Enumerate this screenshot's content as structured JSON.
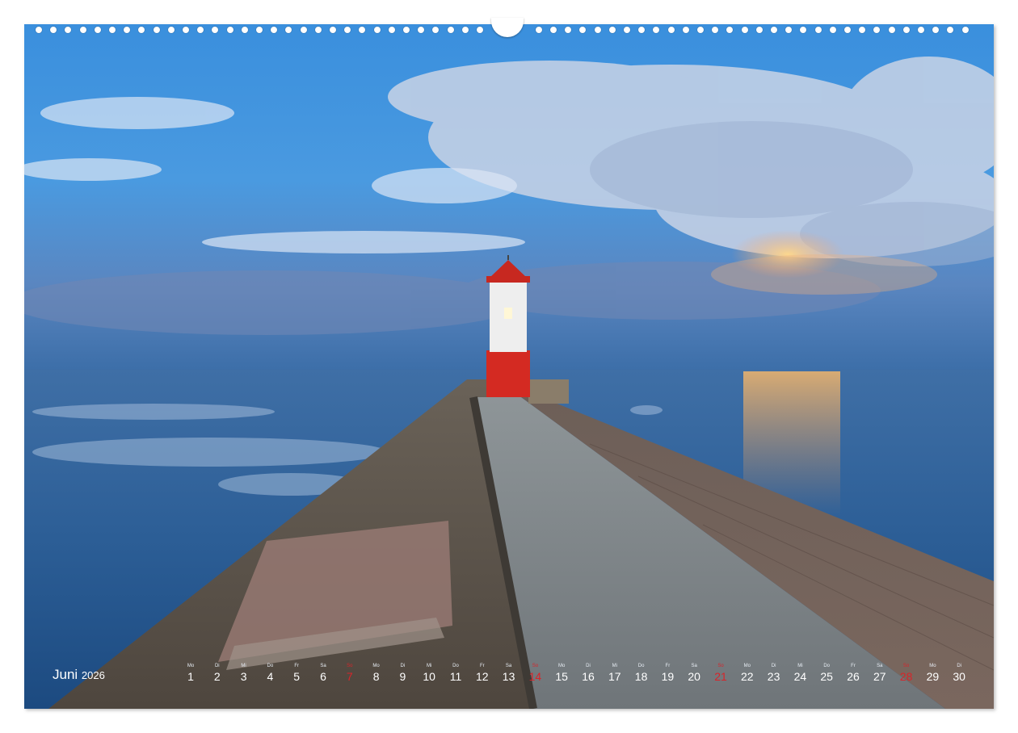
{
  "calendar": {
    "month": "Juni",
    "year": "2026",
    "days": [
      {
        "wd": "Mo",
        "n": "1",
        "sun": false
      },
      {
        "wd": "Di",
        "n": "2",
        "sun": false
      },
      {
        "wd": "Mi",
        "n": "3",
        "sun": false
      },
      {
        "wd": "Do",
        "n": "4",
        "sun": false
      },
      {
        "wd": "Fr",
        "n": "5",
        "sun": false
      },
      {
        "wd": "Sa",
        "n": "6",
        "sun": false
      },
      {
        "wd": "So",
        "n": "7",
        "sun": true
      },
      {
        "wd": "Mo",
        "n": "8",
        "sun": false
      },
      {
        "wd": "Di",
        "n": "9",
        "sun": false
      },
      {
        "wd": "Mi",
        "n": "10",
        "sun": false
      },
      {
        "wd": "Do",
        "n": "11",
        "sun": false
      },
      {
        "wd": "Fr",
        "n": "12",
        "sun": false
      },
      {
        "wd": "Sa",
        "n": "13",
        "sun": false
      },
      {
        "wd": "So",
        "n": "14",
        "sun": true
      },
      {
        "wd": "Mo",
        "n": "15",
        "sun": false
      },
      {
        "wd": "Di",
        "n": "16",
        "sun": false
      },
      {
        "wd": "Mi",
        "n": "17",
        "sun": false
      },
      {
        "wd": "Do",
        "n": "18",
        "sun": false
      },
      {
        "wd": "Fr",
        "n": "19",
        "sun": false
      },
      {
        "wd": "Sa",
        "n": "20",
        "sun": false
      },
      {
        "wd": "So",
        "n": "21",
        "sun": true
      },
      {
        "wd": "Mo",
        "n": "22",
        "sun": false
      },
      {
        "wd": "Di",
        "n": "23",
        "sun": false
      },
      {
        "wd": "Mi",
        "n": "24",
        "sun": false
      },
      {
        "wd": "Do",
        "n": "25",
        "sun": false
      },
      {
        "wd": "Fr",
        "n": "26",
        "sun": false
      },
      {
        "wd": "Sa",
        "n": "27",
        "sun": false
      },
      {
        "wd": "So",
        "n": "28",
        "sun": true
      },
      {
        "wd": "Mo",
        "n": "29",
        "sun": false
      },
      {
        "wd": "Di",
        "n": "30",
        "sun": false
      }
    ]
  },
  "colors": {
    "sunday": "#d8242a",
    "sky_top": "#2f86d6",
    "sea": "#2a5f97",
    "lighthouse_red": "#d42a22"
  }
}
